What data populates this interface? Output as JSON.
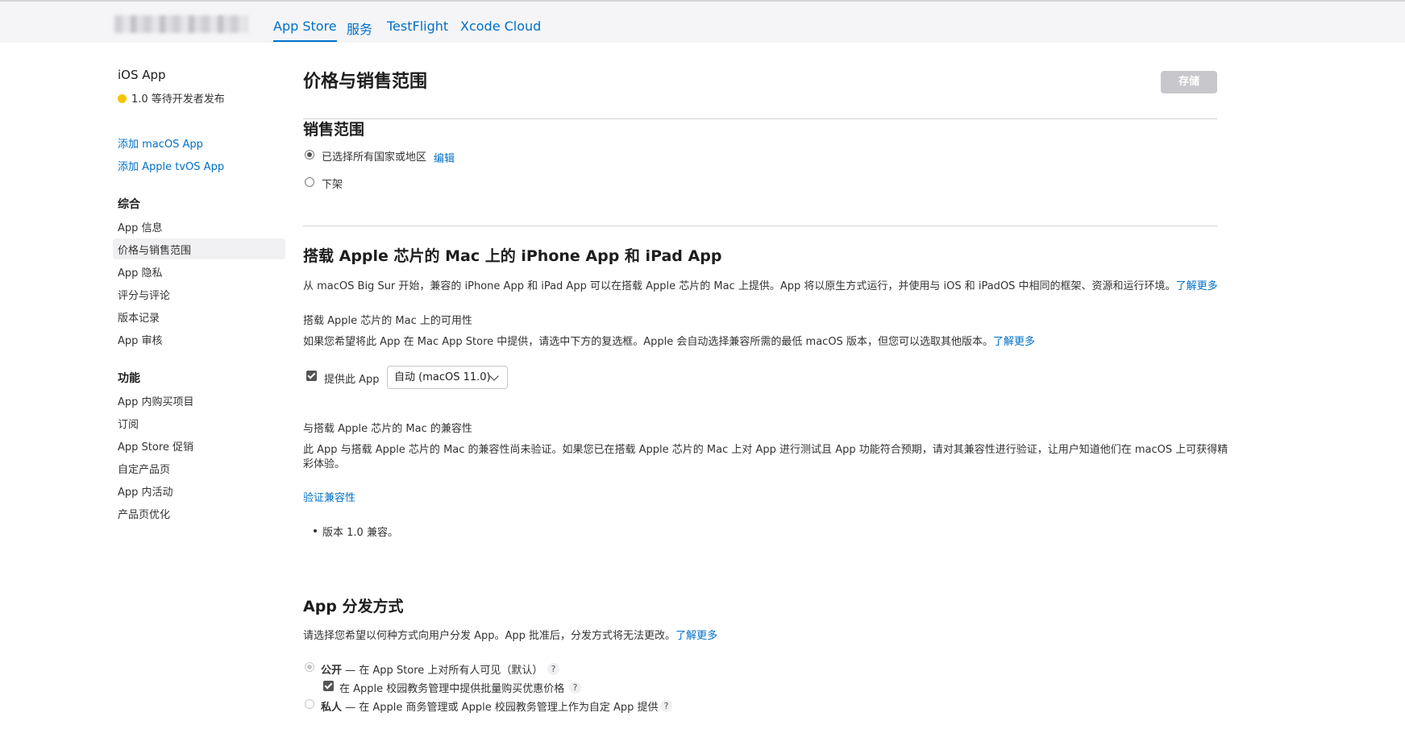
{
  "topbar": {
    "tabs": [
      "App Store",
      "服务",
      "TestFlight",
      "Xcode Cloud"
    ]
  },
  "sidebar": {
    "app_title": "iOS App",
    "status": "1.0 等待开发者发布",
    "add_links": [
      "添加 macOS App",
      "添加 Apple tvOS App"
    ],
    "general_heading": "综合",
    "general_items": [
      "App 信息",
      "价格与销售范围",
      "App 隐私",
      "评分与评论",
      "版本记录",
      "App 审核"
    ],
    "features_heading": "功能",
    "features_items": [
      "App 内购买项目",
      "订阅",
      "App Store 促销",
      "自定产品页",
      "App 内活动",
      "产品页优化"
    ]
  },
  "page": {
    "title": "价格与销售范围",
    "save_label": "存储"
  },
  "availability": {
    "title": "销售范围",
    "option_all": "已选择所有国家或地区",
    "edit_link": "编辑",
    "option_remove": "下架"
  },
  "mac": {
    "title": "搭载 Apple 芯片的 Mac 上的 iPhone App 和 iPad App",
    "desc": "从 macOS Big Sur 开始，兼容的 iPhone App 和 iPad App 可以在搭载 Apple 芯片的 Mac 上提供。App 将以原生方式运行，并使用与 iOS 和 iPadOS 中相同的框架、资源和运行环境。",
    "learn_more": "了解更多",
    "availability_label": "搭载 Apple 芯片的 Mac 上的可用性",
    "availability_desc": "如果您希望将此 App 在 Mac App Store 中提供，请选中下方的复选框。Apple 会自动选择兼容所需的最低 macOS 版本，但您可以选取其他版本。",
    "checkbox_label": "提供此 App",
    "version_value": "自动 (macOS 11.0)",
    "compat_label": "与搭载 Apple 芯片的 Mac 的兼容性",
    "compat_desc_line1": "此 App 与搭载 Apple 芯片的 Mac 的兼容性尚未验证。如果您已在搭载 Apple 芯片的 Mac 上对 App 进行测试且 App 功能符合预期，请对其兼容性进行验证，让用户知道他们在 macOS 上可获得精",
    "compat_desc_line2": "彩体验。",
    "verify_link": "验证兼容性",
    "bullet": "版本 1.0 兼容。"
  },
  "distribution": {
    "title": "App 分发方式",
    "desc": "请选择您希望以何种方式向用户分发 App。App 批准后，分发方式将无法更改。",
    "learn_more": "了解更多",
    "public_bold": "公开",
    "public_rest": " — 在 App Store 上对所有人可见（默认）",
    "edu_checkbox": "在 Apple 校园教务管理中提供批量购买优惠价格",
    "private_bold": "私人",
    "private_rest": " — 在 Apple 商务管理或 Apple 校园教务管理上作为自定 App 提供",
    "help_glyph": "?"
  }
}
